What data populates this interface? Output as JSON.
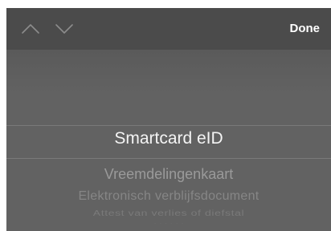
{
  "toolbar": {
    "previous_icon": "chevron-up-icon",
    "next_icon": "chevron-down-icon",
    "done_label": "Done"
  },
  "picker": {
    "selected": "Smartcard eID",
    "items_below": [
      "Vreemdelingenkaart",
      "Elektronisch verblijfsdocument",
      "Attest van verlies of diefstal"
    ]
  }
}
